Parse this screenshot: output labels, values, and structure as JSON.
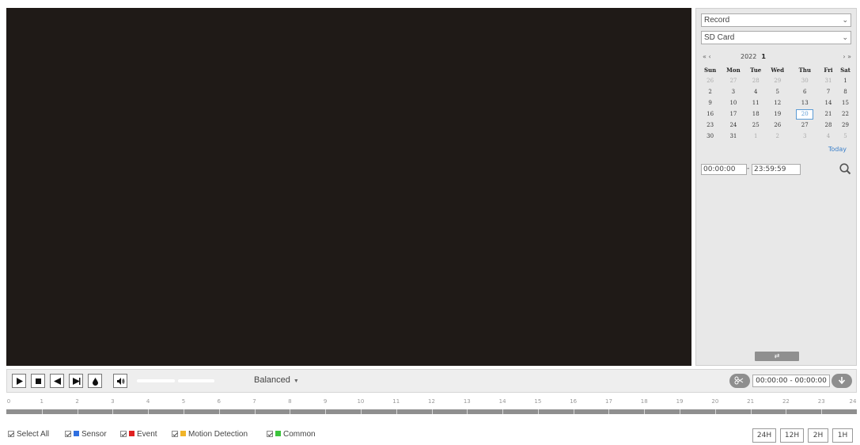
{
  "panel": {
    "type_select": "Record",
    "storage_select": "SD Card",
    "calendar": {
      "prev_nav": "« ‹",
      "next_nav": "› »",
      "year": "2022",
      "month": "1",
      "weekdays": [
        "Sun",
        "Mon",
        "Tue",
        "Wed",
        "Thu",
        "Fri",
        "Sat"
      ],
      "weeks": [
        [
          "26",
          "27",
          "28",
          "29",
          "30",
          "31",
          "1"
        ],
        [
          "2",
          "3",
          "4",
          "5",
          "6",
          "7",
          "8"
        ],
        [
          "9",
          "10",
          "11",
          "12",
          "13",
          "14",
          "15"
        ],
        [
          "16",
          "17",
          "18",
          "19",
          "20",
          "21",
          "22"
        ],
        [
          "23",
          "24",
          "25",
          "26",
          "27",
          "28",
          "29"
        ],
        [
          "30",
          "31",
          "1",
          "2",
          "3",
          "4",
          "5"
        ]
      ],
      "selected_day": "20",
      "today_label": "Today"
    },
    "start_time": "00:00:00",
    "dash": "-",
    "end_time": "23:59:59",
    "swap_label": "⇄"
  },
  "controls": {
    "quality": "Balanced",
    "clip_range": "00:00:00 - 00:00:00"
  },
  "timeline": {
    "hours": [
      "0",
      "1",
      "2",
      "3",
      "4",
      "5",
      "6",
      "7",
      "8",
      "9",
      "10",
      "11",
      "12",
      "13",
      "14",
      "15",
      "16",
      "17",
      "18",
      "19",
      "20",
      "21",
      "22",
      "23",
      "24"
    ]
  },
  "legend": {
    "select_all": "Select All",
    "sensor": "Sensor",
    "event": "Event",
    "motion": "Motion Detection",
    "common": "Common",
    "colors": {
      "sensor": "#2f6fe0",
      "event": "#e02020",
      "motion": "#f0b429",
      "common": "#3cc43c"
    }
  },
  "zoom": {
    "z24": "24H",
    "z12": "12H",
    "z2": "2H",
    "z1": "1H"
  }
}
